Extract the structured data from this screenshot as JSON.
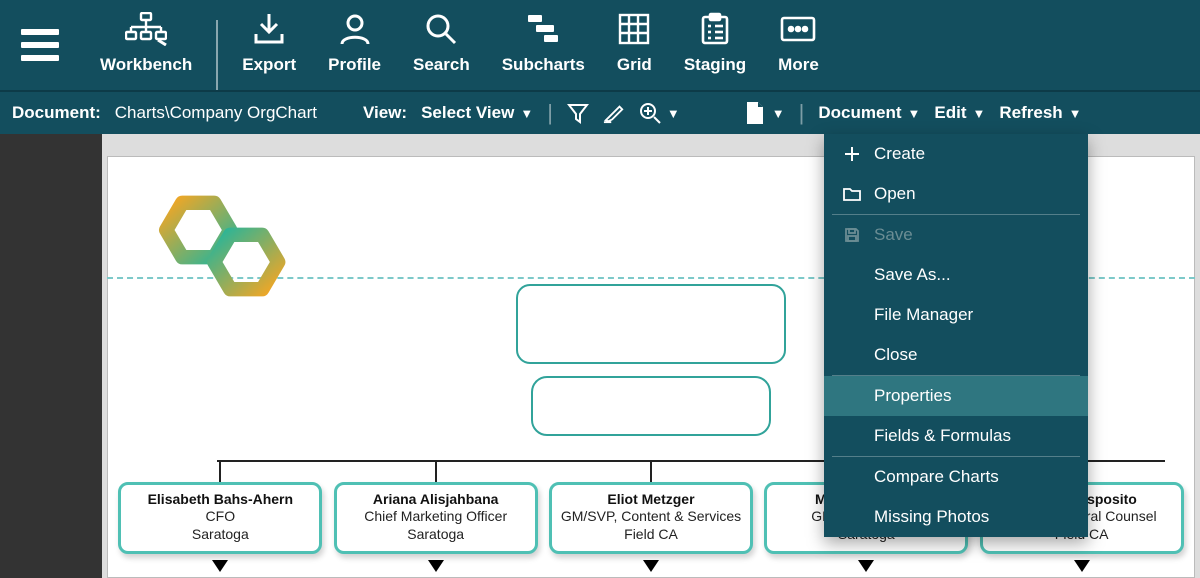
{
  "colors": {
    "brand_dark": "#134e5e",
    "card_border": "#4fc0b4"
  },
  "topbar": {
    "items": [
      {
        "id": "workbench",
        "label": "Workbench"
      },
      {
        "id": "export",
        "label": "Export"
      },
      {
        "id": "profile",
        "label": "Profile"
      },
      {
        "id": "search",
        "label": "Search"
      },
      {
        "id": "subcharts",
        "label": "Subcharts"
      },
      {
        "id": "grid",
        "label": "Grid"
      },
      {
        "id": "staging",
        "label": "Staging"
      },
      {
        "id": "more",
        "label": "More"
      }
    ]
  },
  "subbar": {
    "document_label": "Document:",
    "document_path": "Charts\\Company OrgChart",
    "view_label": "View:",
    "view_value": "Select View",
    "right": {
      "document": "Document",
      "edit": "Edit",
      "refresh": "Refresh"
    }
  },
  "document_menu": {
    "create": "Create",
    "open": "Open",
    "save": "Save",
    "save_as": "Save As...",
    "file_manager": "File Manager",
    "close": "Close",
    "properties": "Properties",
    "fields_formulas": "Fields & Formulas",
    "compare_charts": "Compare Charts",
    "missing_photos": "Missing Photos"
  },
  "chart": {
    "people": [
      {
        "name": "Elisabeth Bahs-Ahern",
        "title": "CFO",
        "location": "Saratoga"
      },
      {
        "name": "Ariana Alisjahbana",
        "title": "Chief Marketing Officer",
        "location": "Saratoga"
      },
      {
        "name": "Eliot Metzger",
        "title": "GM/SVP, Content & Services",
        "location": "Field CA"
      },
      {
        "name": "Margaret Beiter",
        "title": "GM/SVP, Devices",
        "location": "Saratoga"
      },
      {
        "name": "Ronald Esposito",
        "title": "SVP & General Counsel",
        "location": "Field CA"
      }
    ]
  }
}
